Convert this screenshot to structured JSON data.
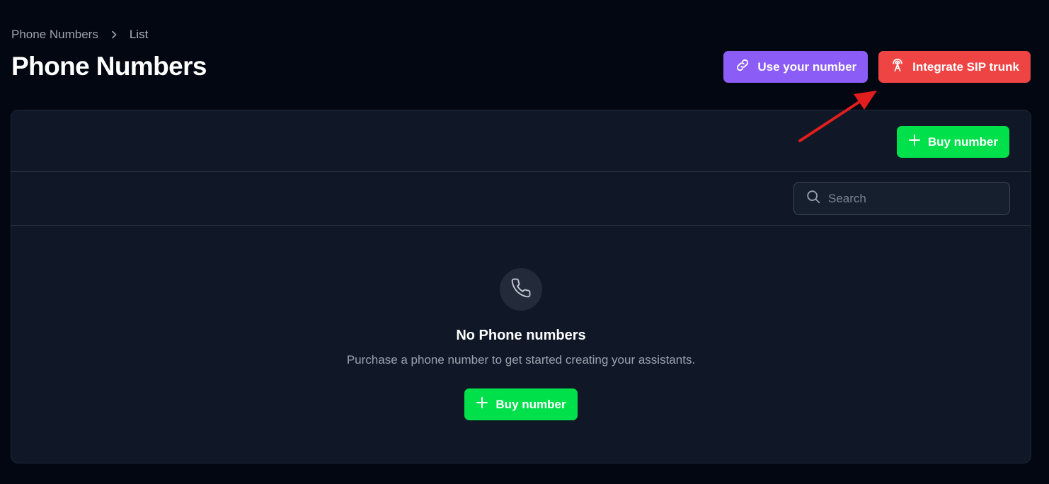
{
  "breadcrumb": {
    "root": "Phone Numbers",
    "current": "List"
  },
  "page_title": "Phone Numbers",
  "header_actions": {
    "use_number_label": "Use your number",
    "sip_trunk_label": "Integrate SIP trunk"
  },
  "toolbar": {
    "buy_number_label": "Buy number"
  },
  "search": {
    "placeholder": "Search",
    "value": ""
  },
  "empty_state": {
    "title": "No Phone numbers",
    "description": "Purchase a phone number to get started creating your assistants.",
    "buy_number_label": "Buy number"
  },
  "icons": {
    "chevron": "chevron-right-icon",
    "link": "link-icon",
    "antenna": "antenna-icon",
    "plus": "plus-icon",
    "search": "search-icon",
    "phone": "phone-icon"
  },
  "colors": {
    "background": "#030712",
    "card": "#101827",
    "purple_button": "#8b5cf6",
    "red_button": "#ef4444",
    "green_button": "#00e04b",
    "annotation_arrow": "#e11d1d"
  }
}
